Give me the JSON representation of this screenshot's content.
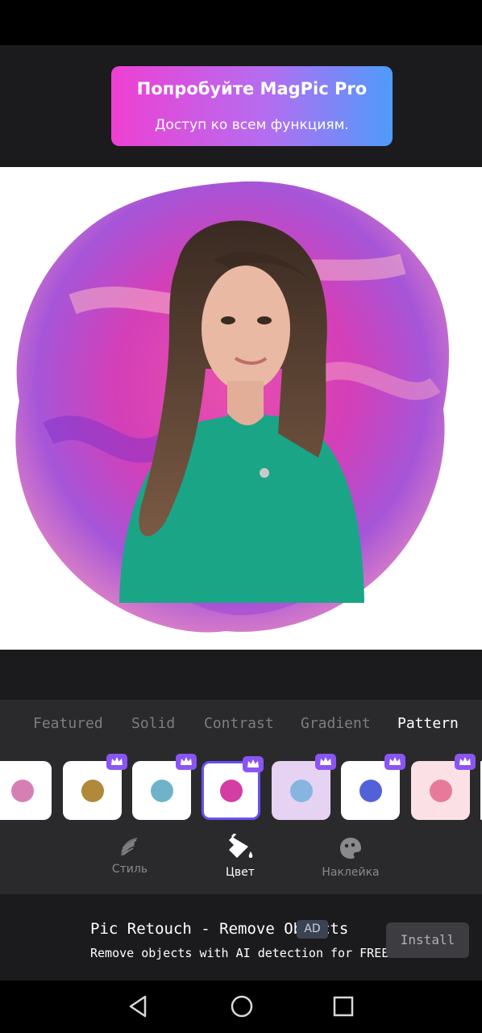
{
  "pro_banner": {
    "title": "Попробуйте MagPic Pro",
    "subtitle": "Доступ ко всем функциям."
  },
  "photo": {
    "alt": "portrait-with-pink-paint-background"
  },
  "category_tabs": [
    {
      "label": "Featured",
      "active": false
    },
    {
      "label": "Solid",
      "active": false
    },
    {
      "label": "Contrast",
      "active": false
    },
    {
      "label": "Gradient",
      "active": false
    },
    {
      "label": "Pattern",
      "active": true
    }
  ],
  "pattern_thumbs": [
    {
      "color": "#d67fb4",
      "bg": "#ffffff",
      "premium": false,
      "selected": false
    },
    {
      "color": "#b08a3a",
      "bg": "#ffffff",
      "premium": true,
      "selected": false
    },
    {
      "color": "#6fb3c9",
      "bg": "#ffffff",
      "premium": true,
      "selected": false
    },
    {
      "color": "#d23ea3",
      "bg": "#ffffff",
      "premium": true,
      "selected": true
    },
    {
      "color": "#86b5e0",
      "bg": "#e6d2f2",
      "premium": true,
      "selected": false
    },
    {
      "color": "#5361d8",
      "bg": "#ffffff",
      "premium": true,
      "selected": false
    },
    {
      "color": "#e77a9a",
      "bg": "#fbe1e6",
      "premium": true,
      "selected": false
    }
  ],
  "tools": [
    {
      "label": "Стиль",
      "icon": "brush-icon",
      "active": false
    },
    {
      "label": "Цвет",
      "icon": "paint-bucket-icon",
      "active": true
    },
    {
      "label": "Наклейка",
      "icon": "sticker-icon",
      "active": false
    }
  ],
  "ad": {
    "title": "Pic Retouch - Remove Objects",
    "badge": "AD",
    "subtitle": "Remove objects with AI detection for FREE.",
    "install_label": "Install"
  },
  "navbar": [
    "back-icon",
    "home-icon",
    "recents-icon"
  ],
  "colors": {
    "accent": "#6b4ff0",
    "premium": "#8b55f2",
    "banner_start": "#ee40d2",
    "banner_end": "#4f9bfb"
  }
}
